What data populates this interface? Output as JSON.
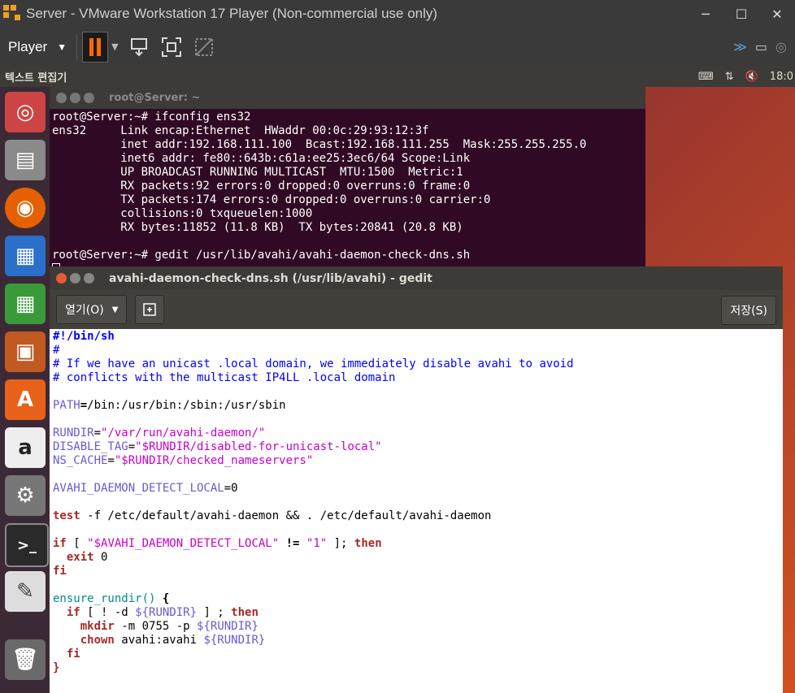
{
  "vmware": {
    "title": "Server - VMware Workstation 17 Player (Non-commercial use only)",
    "player_menu": "Player"
  },
  "panel": {
    "app_name": "텍스트 편집기",
    "time": "18:0"
  },
  "terminal": {
    "title": "root@Server: ~",
    "lines": [
      "root@Server:~# ifconfig ens32",
      "ens32     Link encap:Ethernet  HWaddr 00:0c:29:93:12:3f  ",
      "          inet addr:192.168.111.100  Bcast:192.168.111.255  Mask:255.255.255.0",
      "          inet6 addr: fe80::643b:c61a:ee25:3ec6/64 Scope:Link",
      "          UP BROADCAST RUNNING MULTICAST  MTU:1500  Metric:1",
      "          RX packets:92 errors:0 dropped:0 overruns:0 frame:0",
      "          TX packets:174 errors:0 dropped:0 overruns:0 carrier:0",
      "          collisions:0 txqueuelen:1000 ",
      "          RX bytes:11852 (11.8 KB)  TX bytes:20841 (20.8 KB)",
      "",
      "root@Server:~# gedit /usr/lib/avahi/avahi-daemon-check-dns.sh"
    ]
  },
  "gedit": {
    "title": "avahi-daemon-check-dns.sh (/usr/lib/avahi) - gedit",
    "open_label": "열기(O)",
    "save_label": "저장(S)",
    "code": {
      "l1": "#!/bin/sh",
      "l2": "#",
      "l3": "# If we have an unicast .local domain, we immediately disable avahi to avoid",
      "l4": "# conflicts with the multicast IP4LL .local domain",
      "path_var": "PATH",
      "path_val": "/bin:/usr/bin:/sbin:/usr/sbin",
      "rundir_var": "RUNDIR",
      "rundir_val": "\"/var/run/avahi-daemon/\"",
      "dtag_var": "DISABLE_TAG",
      "dtag_val": "\"$RUNDIR/disabled-for-unicast-local\"",
      "nsc_var": "NS_CACHE",
      "nsc_val": "\"$RUNDIR/checked_nameservers\"",
      "adl_var": "AVAHI_DAEMON_DETECT_LOCAL",
      "adl_val": "0",
      "test_kw": "test",
      "test_rest": " -f /etc/default/avahi-daemon && . /etc/default/avahi-daemon",
      "if_kw": "if",
      "if_mid": " [ ",
      "if_str": "\"$AVAHI_DAEMON_DETECT_LOCAL\"",
      "if_op": " != ",
      "if_str2": "\"1\"",
      "if_end": " ]; ",
      "then_kw": "then",
      "exit_kw": "exit",
      "exit_val": " 0",
      "fi_kw": "fi",
      "fn_name": "ensure_rundir()",
      "fn_brace": " {",
      "if2_kw": "if",
      "if2_mid": " [ ! -d ",
      "if2_var": "${RUNDIR}",
      "if2_end": " ] ; ",
      "then2_kw": "then",
      "mkdir_kw": "mkdir",
      "mkdir_rest": " -m 0755 -p ",
      "mkdir_var": "${RUNDIR}",
      "chown_kw": "chown",
      "chown_rest": " avahi:avahi ",
      "chown_var": "${RUNDIR}",
      "fi2_kw": "fi",
      "close_brace": "}"
    }
  },
  "launcher": [
    "ubuntu-dash-icon",
    "files-icon",
    "firefox-icon",
    "writer-icon",
    "calc-icon",
    "impress-icon",
    "software-center-icon",
    "amazon-icon",
    "system-settings-icon",
    "terminal-icon",
    "text-editor-icon",
    "trash-icon"
  ]
}
